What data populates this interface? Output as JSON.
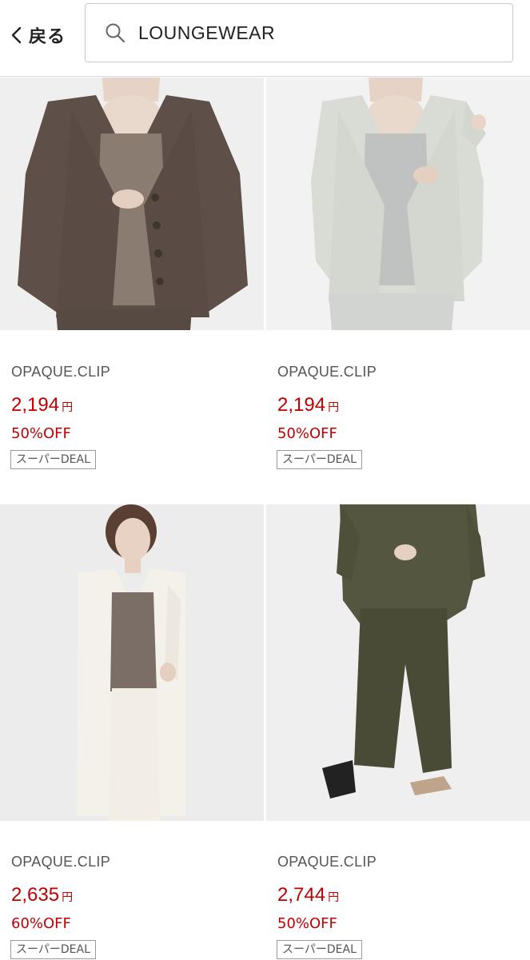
{
  "header": {
    "back_label": "戻る",
    "search_value": "LOUNGEWEAR"
  },
  "products": [
    {
      "brand": "OPAQUE.CLIP",
      "price": "2,194",
      "currency": "円",
      "discount": "50%OFF",
      "badge": "スーパーDEAL",
      "garment_color": "#5e5048",
      "inner_color": "#8b7c72",
      "bg_color": "#efefef"
    },
    {
      "brand": "OPAQUE.CLIP",
      "price": "2,194",
      "currency": "円",
      "discount": "50%OFF",
      "badge": "スーパーDEAL",
      "garment_color": "#d8dcd5",
      "inner_color": "#bfc2c0",
      "bg_color": "#f2f2f2"
    },
    {
      "brand": "OPAQUE.CLIP",
      "price": "2,635",
      "currency": "円",
      "discount": "60%OFF",
      "badge": "スーパーDEAL",
      "garment_color": "#f4f1ea",
      "inner_color": "#7a6e66",
      "bg_color": "#ececec"
    },
    {
      "brand": "OPAQUE.CLIP",
      "price": "2,744",
      "currency": "円",
      "discount": "50%OFF",
      "badge": "スーパーDEAL",
      "garment_color": "#54563f",
      "inner_color": "#494b36",
      "bg_color": "#efefef"
    }
  ]
}
